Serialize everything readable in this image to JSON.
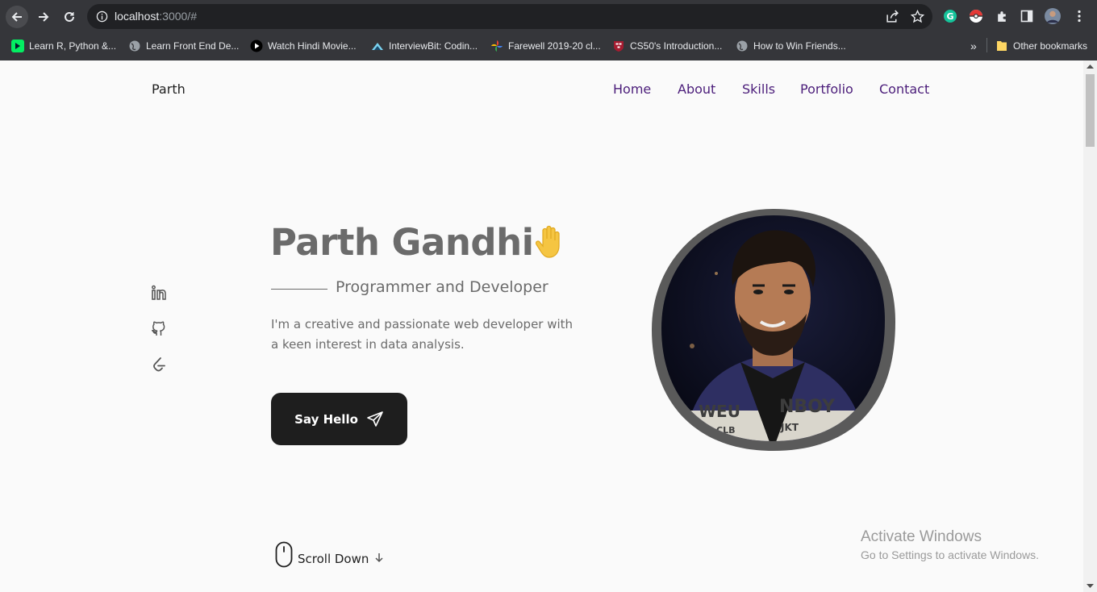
{
  "browser": {
    "url_host": "localhost",
    "url_path": ":3000/#",
    "bookmarks": [
      {
        "label": "Learn R, Python &...",
        "icon": "datacamp-icon",
        "color": "#03ef62"
      },
      {
        "label": "Learn Front End De...",
        "icon": "globe-icon",
        "color": "#9aa0a6"
      },
      {
        "label": "Watch Hindi Movie...",
        "icon": "play-icon",
        "color": "#000000"
      },
      {
        "label": "InterviewBit: Codin...",
        "icon": "interviewbit-icon",
        "color": "#79d2f0"
      },
      {
        "label": "Farewell 2019-20 cl...",
        "icon": "pinwheel-icon",
        "color": "#fbbc04"
      },
      {
        "label": "CS50's Introduction...",
        "icon": "harvard-icon",
        "color": "#a51c30"
      },
      {
        "label": "How to Win Friends...",
        "icon": "globe-icon",
        "color": "#9aa0a6"
      }
    ],
    "more_bookmarks": "»",
    "other_bookmarks": "Other bookmarks"
  },
  "site": {
    "brand": "Parth",
    "nav": [
      "Home",
      "About",
      "Skills",
      "Portfolio",
      "Contact"
    ],
    "nav_color": "#4b1d7a"
  },
  "hero": {
    "title": "Parth Gandhi",
    "subtitle": "Programmer and Developer",
    "description": "I'm a creative and passionate web developer with a keen interest in data analysis.",
    "button_label": "Say Hello",
    "scroll_label": "Scroll Down",
    "social_icons": [
      "linkedin-icon",
      "github-icon",
      "leetcode-icon"
    ]
  },
  "windows_watermark": {
    "line1": "Activate Windows",
    "line2": "Go to Settings to activate Windows."
  }
}
